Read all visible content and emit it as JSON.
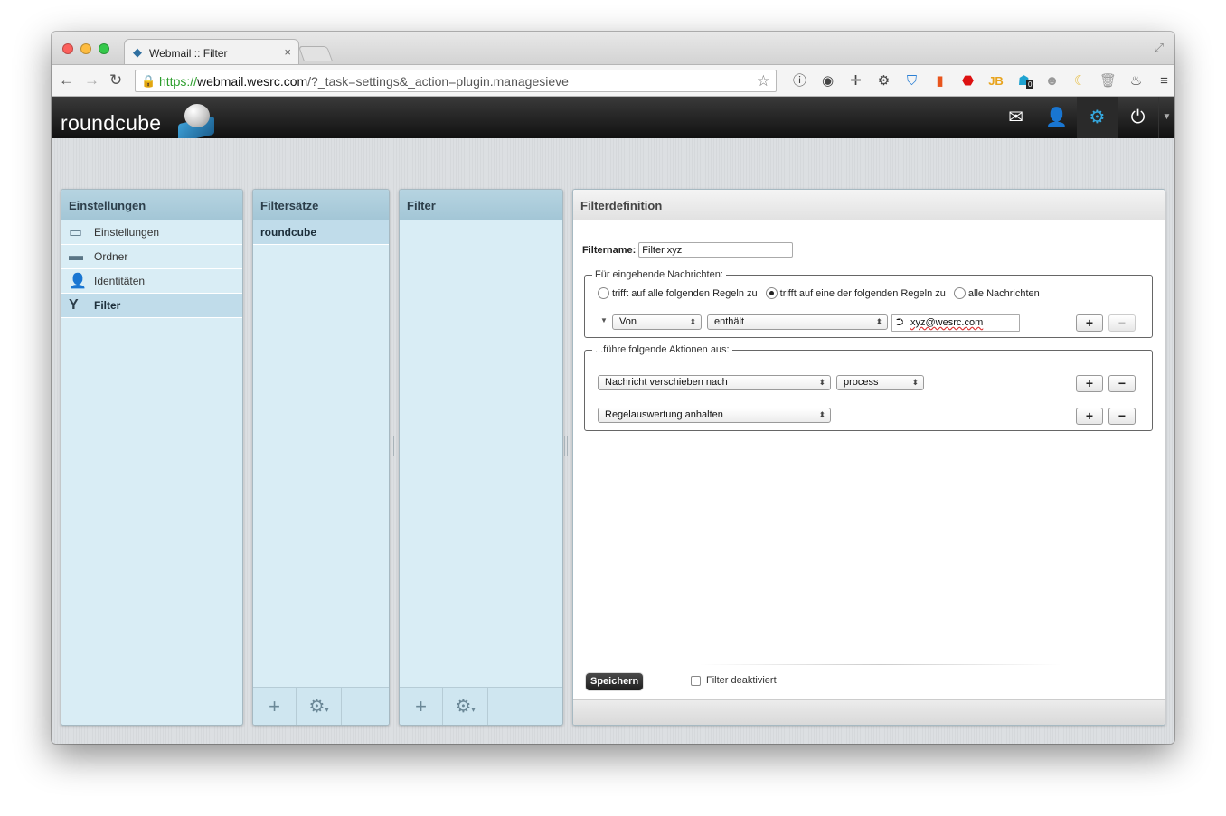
{
  "browser": {
    "tab_title": "Webmail :: Filter",
    "tab_close": "×",
    "url": {
      "scheme": "https://",
      "host": "webmail.wesrc.com",
      "path": "/?_task=settings&_action=plugin.managesieve"
    },
    "extensions": [
      "info-icon",
      "color-wheel-icon",
      "crosshair-icon",
      "gear-icon",
      "shield-icon",
      "bookmark-icon",
      "stop-icon",
      "jb-icon",
      "ghost-icon",
      "alien-icon",
      "moon-icon",
      "trash-icon",
      "flame-icon",
      "menu-icon"
    ],
    "ghost_badge": "0"
  },
  "header": {
    "logo": "roundcube"
  },
  "settings_panel": {
    "title": "Einstellungen",
    "items": [
      {
        "label": "Einstellungen",
        "icon": "monitor-icon"
      },
      {
        "label": "Ordner",
        "icon": "folder-icon"
      },
      {
        "label": "Identitäten",
        "icon": "person-icon"
      },
      {
        "label": "Filter",
        "icon": "filter-icon"
      }
    ]
  },
  "filtersets_panel": {
    "title": "Filtersätze",
    "items": [
      {
        "label": "roundcube"
      }
    ]
  },
  "filter_panel": {
    "title": "Filter"
  },
  "definition": {
    "title": "Filterdefinition",
    "filtername_label": "Filtername:",
    "filtername_value": "Filter xyz",
    "incoming_legend": "Für eingehende Nachrichten:",
    "match_options": [
      {
        "label": "trifft auf alle folgenden Regeln zu",
        "checked": false
      },
      {
        "label": "trifft auf eine der folgenden Regeln zu",
        "checked": true
      },
      {
        "label": "alle Nachrichten",
        "checked": false
      }
    ],
    "rule": {
      "header": "Von",
      "operator": "enthält",
      "value": "xyz@wesrc.com"
    },
    "actions_legend": "...führe folgende Aktionen aus:",
    "actions": [
      {
        "type": "Nachricht verschieben nach",
        "target": "process"
      },
      {
        "type": "Regelauswertung anhalten"
      }
    ],
    "plus": "+",
    "minus": "−",
    "save_label": "Speichern",
    "disable_label": "Filter deaktiviert"
  }
}
